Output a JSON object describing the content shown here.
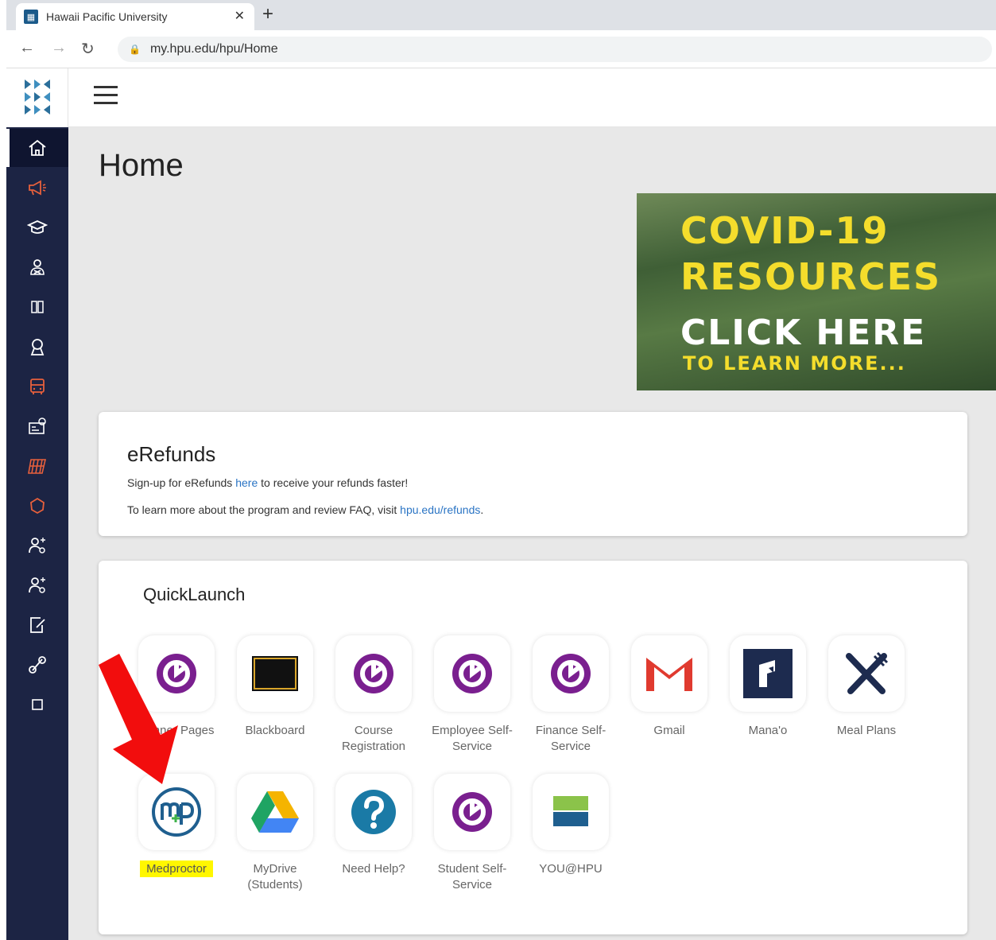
{
  "browser": {
    "tab_title": "Hawaii Pacific University",
    "tab_close": "✕",
    "new_tab": "+",
    "url": "my.hpu.edu/hpu/Home"
  },
  "sidebar": {
    "items": [
      {
        "icon": "home-icon",
        "active": true
      },
      {
        "icon": "megaphone-icon"
      },
      {
        "icon": "graduation-cap-icon"
      },
      {
        "icon": "users-icon"
      },
      {
        "icon": "columns-icon"
      },
      {
        "icon": "location-pin-icon"
      },
      {
        "icon": "bus-icon"
      },
      {
        "icon": "id-card-icon"
      },
      {
        "icon": "calendar-icon"
      },
      {
        "icon": "globe-icon"
      },
      {
        "icon": "person-settings-icon"
      },
      {
        "icon": "person-settings-icon"
      },
      {
        "icon": "edit-note-icon"
      },
      {
        "icon": "link-icon"
      },
      {
        "icon": "square-icon"
      }
    ],
    "colors": {
      "bg": "#1c2444",
      "accent": "#e8603c"
    }
  },
  "main": {
    "title": "Home",
    "banner": {
      "line1": "COVID-19",
      "line2": "RESOURCES",
      "line3": "CLICK HERE",
      "line4": "TO LEARN MORE..."
    },
    "erefunds": {
      "title": "eRefunds",
      "line1_pre": "Sign-up for eRefunds ",
      "line1_link": "here",
      "line1_post": " to receive your refunds faster!",
      "line2_pre": "To learn more about the program and review FAQ, visit ",
      "line2_link": "hpu.edu/refunds",
      "line2_post": "."
    },
    "quicklaunch": {
      "title": "QuickLaunch",
      "tiles": [
        {
          "label": "Banner Pages",
          "icon": "power-purple-icon"
        },
        {
          "label": "Blackboard",
          "icon": "blackboard-icon"
        },
        {
          "label": "Course Registration",
          "icon": "power-purple-icon"
        },
        {
          "label": "Employee Self-Service",
          "icon": "power-purple-icon"
        },
        {
          "label": "Finance Self-Service",
          "icon": "power-purple-icon"
        },
        {
          "label": "Gmail",
          "icon": "gmail-icon"
        },
        {
          "label": "Mana'o",
          "icon": "manao-icon"
        },
        {
          "label": "Meal Plans",
          "icon": "fork-knife-icon"
        },
        {
          "label": "Medproctor",
          "icon": "medproctor-icon"
        },
        {
          "label": "MyDrive (Students)",
          "icon": "google-drive-icon"
        },
        {
          "label": "Need Help?",
          "icon": "help-icon"
        },
        {
          "label": "Student Self-Service",
          "icon": "power-purple-icon"
        },
        {
          "label": "YOU@HPU",
          "icon": "youhpu-icon"
        }
      ]
    }
  }
}
